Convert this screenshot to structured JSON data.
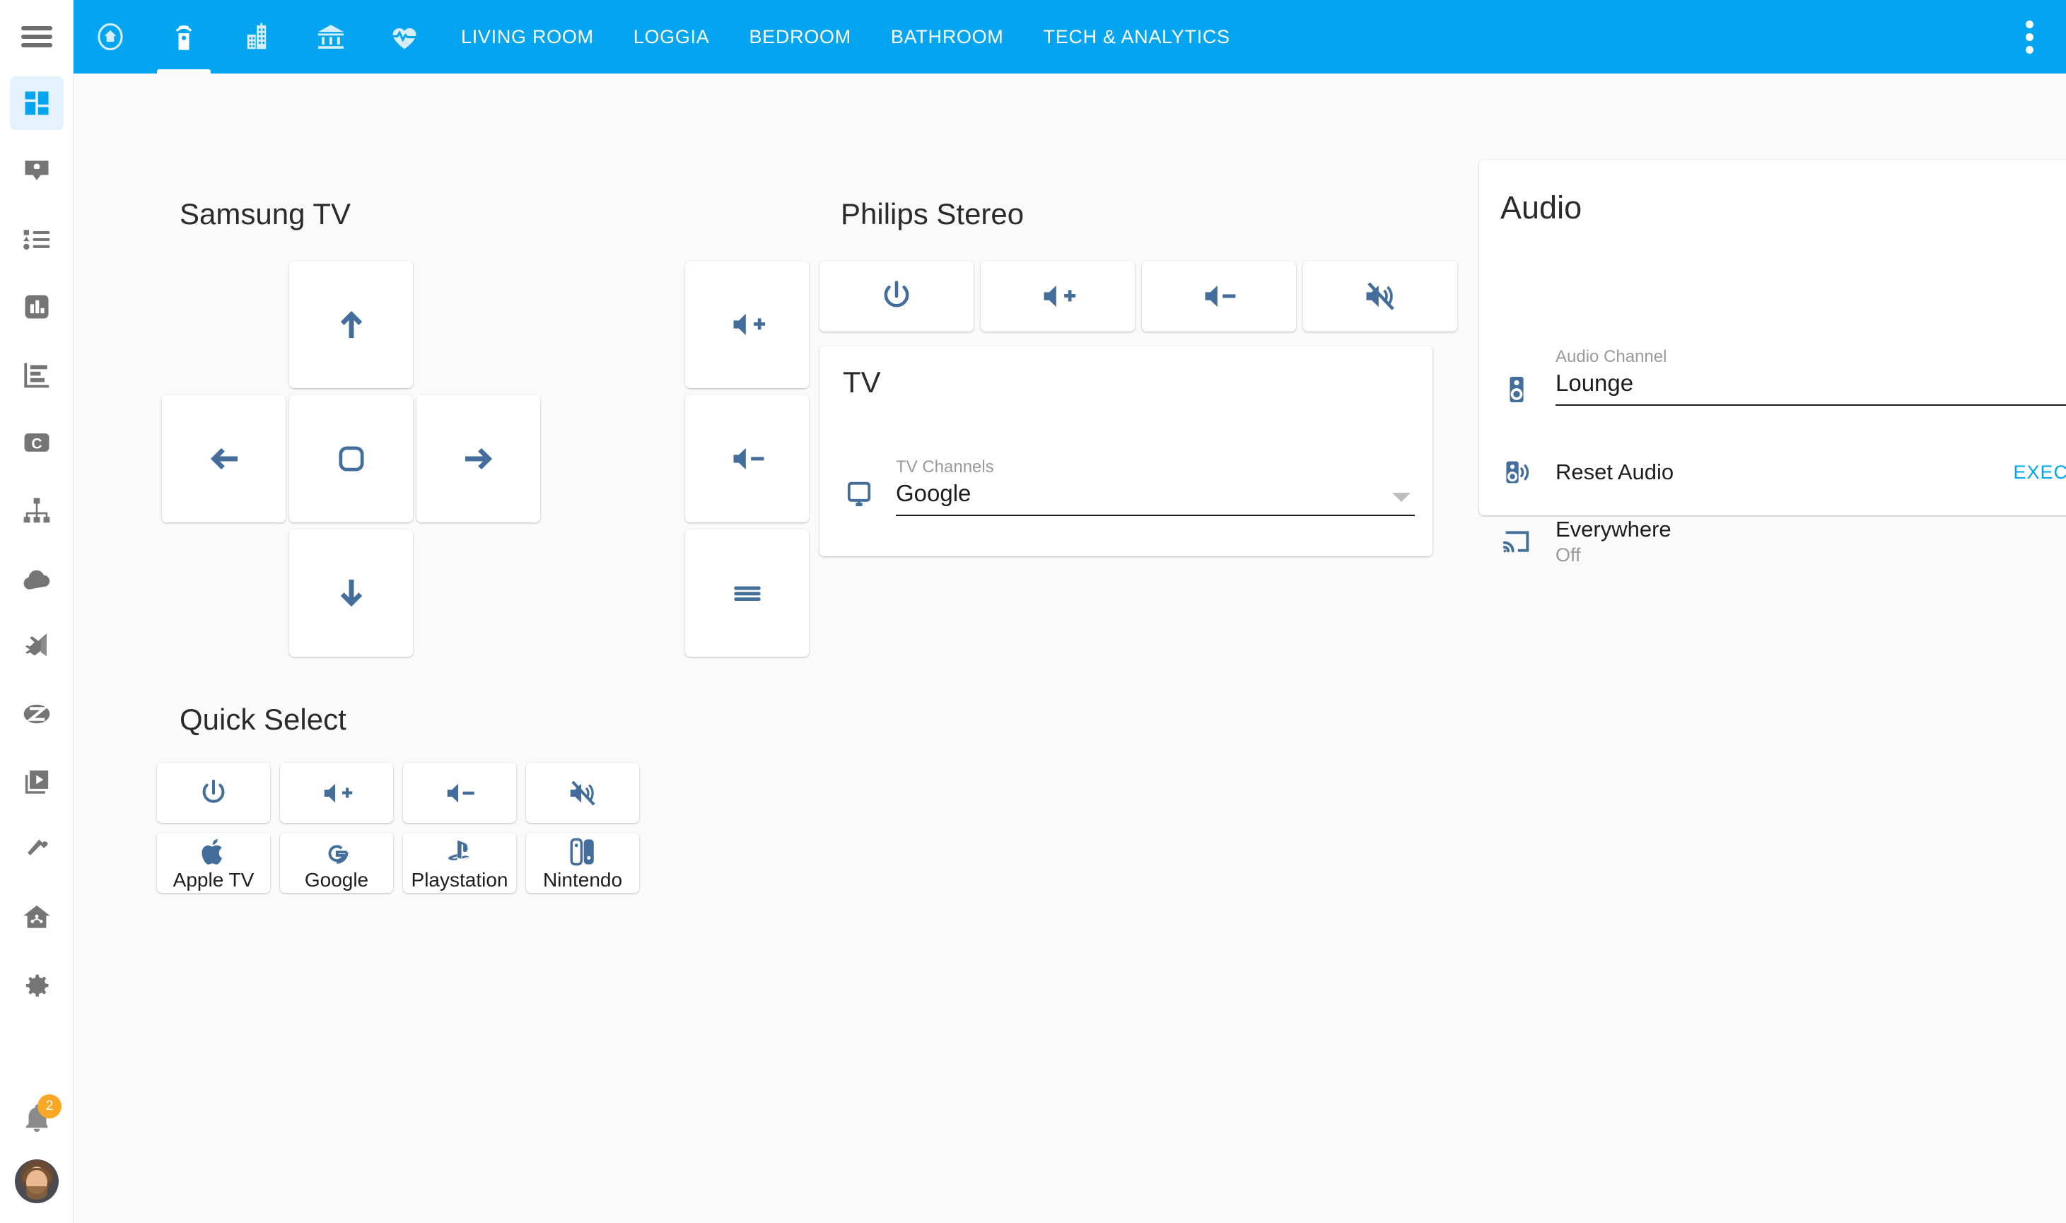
{
  "header": {
    "menu_icon": "hamburger-icon",
    "icon_tabs": [
      {
        "name": "home",
        "icon": "home-circle-icon",
        "active": false
      },
      {
        "name": "remote",
        "icon": "remote-control-icon",
        "active": true
      },
      {
        "name": "building",
        "icon": "office-building-icon",
        "active": false
      },
      {
        "name": "bank",
        "icon": "bank-icon",
        "active": false
      },
      {
        "name": "health",
        "icon": "heart-pulse-icon",
        "active": false
      }
    ],
    "text_tabs": [
      {
        "label": "LIVING ROOM",
        "active": false
      },
      {
        "label": "LOGGIA",
        "active": false
      },
      {
        "label": "BEDROOM",
        "active": false
      },
      {
        "label": "BATHROOM",
        "active": false
      },
      {
        "label": "TECH & ANALYTICS",
        "active": false
      }
    ],
    "overflow_icon": "dots-vertical-icon",
    "background_color": "#03A5F0"
  },
  "sidebar": {
    "items": [
      {
        "name": "dashboard",
        "icon": "view-dashboard-icon",
        "active": true
      },
      {
        "name": "contacts",
        "icon": "account-box-icon",
        "active": false
      },
      {
        "name": "list",
        "icon": "format-list-icon",
        "active": false
      },
      {
        "name": "statistics",
        "icon": "chart-box-icon",
        "active": false
      },
      {
        "name": "history",
        "icon": "chart-timeline-icon",
        "active": false
      },
      {
        "name": "console",
        "icon": "letter-c-box-icon",
        "active": false
      },
      {
        "name": "network",
        "icon": "sitemap-icon",
        "active": false
      },
      {
        "name": "cloud",
        "icon": "cloud-icon",
        "active": false
      },
      {
        "name": "code-editor",
        "icon": "vscode-icon",
        "active": false
      },
      {
        "name": "zigbee",
        "icon": "zigbee-icon",
        "active": false
      },
      {
        "name": "media",
        "icon": "video-library-icon",
        "active": false
      },
      {
        "name": "tools",
        "icon": "hammer-icon",
        "active": false
      },
      {
        "name": "smart-home",
        "icon": "home-automation-icon",
        "active": false
      },
      {
        "name": "settings",
        "icon": "cog-icon",
        "active": false
      }
    ],
    "notifications": {
      "icon": "bell-icon",
      "count": "2",
      "badge_color": "#F9A825"
    },
    "avatar": {
      "name": "user-avatar"
    }
  },
  "samsung_tv": {
    "title": "Samsung TV",
    "buttons": [
      {
        "name": "dpad-up",
        "icon": "arrow-up-icon"
      },
      {
        "name": "dpad-left",
        "icon": "arrow-left-icon"
      },
      {
        "name": "dpad-ok",
        "icon": "rounded-square-icon"
      },
      {
        "name": "dpad-right",
        "icon": "arrow-right-icon"
      },
      {
        "name": "dpad-down",
        "icon": "arrow-down-icon"
      }
    ]
  },
  "volume_strip": {
    "buttons": [
      {
        "name": "volume-up",
        "icon": "volume-plus-icon"
      },
      {
        "name": "volume-down",
        "icon": "volume-minus-icon"
      },
      {
        "name": "menu",
        "icon": "menu-lines-icon"
      }
    ]
  },
  "philips_stereo": {
    "title": "Philips Stereo",
    "buttons": [
      {
        "name": "power",
        "icon": "power-icon"
      },
      {
        "name": "volume-up",
        "icon": "volume-plus-icon"
      },
      {
        "name": "volume-down",
        "icon": "volume-minus-icon"
      },
      {
        "name": "mute",
        "icon": "volume-mute-icon"
      }
    ]
  },
  "tv_card": {
    "title": "TV",
    "icon": "monitor-icon",
    "field_label": "TV Channels",
    "field_value": "Google",
    "caret_icon": "chevron-down-icon"
  },
  "quick_select": {
    "title": "Quick Select",
    "controls": [
      {
        "name": "power",
        "icon": "power-icon"
      },
      {
        "name": "volume-up",
        "icon": "volume-plus-icon"
      },
      {
        "name": "volume-down",
        "icon": "volume-minus-icon"
      },
      {
        "name": "mute",
        "icon": "volume-mute-icon"
      }
    ],
    "sources": [
      {
        "label": "Apple TV",
        "icon": "apple-icon"
      },
      {
        "label": "Google",
        "icon": "google-g-icon"
      },
      {
        "label": "Playstation",
        "icon": "playstation-icon"
      },
      {
        "label": "Nintendo",
        "icon": "nintendo-switch-icon"
      }
    ]
  },
  "audio_card": {
    "title": "Audio",
    "channel": {
      "icon": "speaker-icon",
      "label": "Audio Channel",
      "value": "Lounge",
      "caret_icon": "chevron-down-icon"
    },
    "reset": {
      "icon": "speaker-wireless-icon",
      "label": "Reset Audio",
      "action_label": "EXECUTE",
      "action_color": "#03A5F0"
    },
    "everywhere": {
      "icon": "cast-icon",
      "label": "Everywhere",
      "state": "Off",
      "toggle_icon": "power-icon"
    }
  },
  "colors": {
    "accent": "#03A5F0",
    "icon_blue": "#436E9B",
    "background": "#FAFAFA",
    "sidebar_icon": "#757575"
  }
}
